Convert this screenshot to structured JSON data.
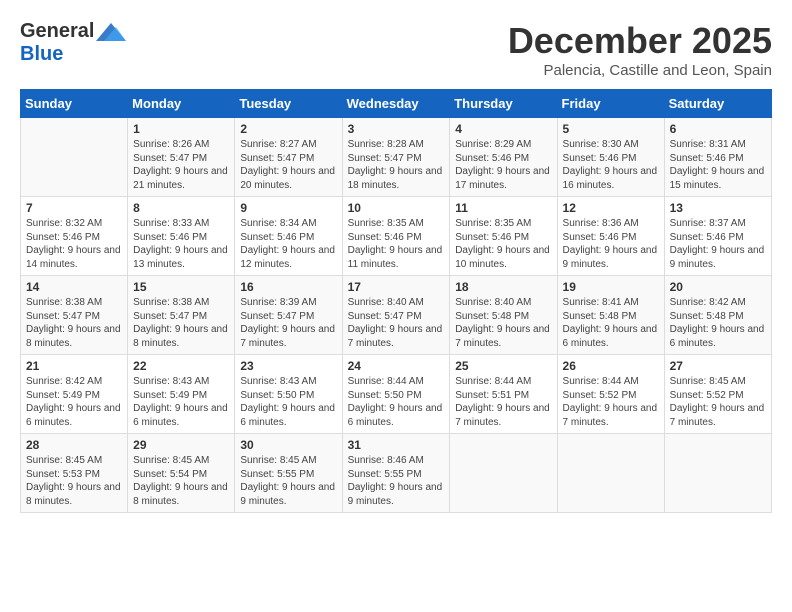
{
  "logo": {
    "general": "General",
    "blue": "Blue"
  },
  "title": "December 2025",
  "subtitle": "Palencia, Castille and Leon, Spain",
  "headers": [
    "Sunday",
    "Monday",
    "Tuesday",
    "Wednesday",
    "Thursday",
    "Friday",
    "Saturday"
  ],
  "weeks": [
    [
      {
        "day": "",
        "sunrise": "",
        "sunset": "",
        "daylight": ""
      },
      {
        "day": "1",
        "sunrise": "Sunrise: 8:26 AM",
        "sunset": "Sunset: 5:47 PM",
        "daylight": "Daylight: 9 hours and 21 minutes."
      },
      {
        "day": "2",
        "sunrise": "Sunrise: 8:27 AM",
        "sunset": "Sunset: 5:47 PM",
        "daylight": "Daylight: 9 hours and 20 minutes."
      },
      {
        "day": "3",
        "sunrise": "Sunrise: 8:28 AM",
        "sunset": "Sunset: 5:47 PM",
        "daylight": "Daylight: 9 hours and 18 minutes."
      },
      {
        "day": "4",
        "sunrise": "Sunrise: 8:29 AM",
        "sunset": "Sunset: 5:46 PM",
        "daylight": "Daylight: 9 hours and 17 minutes."
      },
      {
        "day": "5",
        "sunrise": "Sunrise: 8:30 AM",
        "sunset": "Sunset: 5:46 PM",
        "daylight": "Daylight: 9 hours and 16 minutes."
      },
      {
        "day": "6",
        "sunrise": "Sunrise: 8:31 AM",
        "sunset": "Sunset: 5:46 PM",
        "daylight": "Daylight: 9 hours and 15 minutes."
      }
    ],
    [
      {
        "day": "7",
        "sunrise": "Sunrise: 8:32 AM",
        "sunset": "Sunset: 5:46 PM",
        "daylight": "Daylight: 9 hours and 14 minutes."
      },
      {
        "day": "8",
        "sunrise": "Sunrise: 8:33 AM",
        "sunset": "Sunset: 5:46 PM",
        "daylight": "Daylight: 9 hours and 13 minutes."
      },
      {
        "day": "9",
        "sunrise": "Sunrise: 8:34 AM",
        "sunset": "Sunset: 5:46 PM",
        "daylight": "Daylight: 9 hours and 12 minutes."
      },
      {
        "day": "10",
        "sunrise": "Sunrise: 8:35 AM",
        "sunset": "Sunset: 5:46 PM",
        "daylight": "Daylight: 9 hours and 11 minutes."
      },
      {
        "day": "11",
        "sunrise": "Sunrise: 8:35 AM",
        "sunset": "Sunset: 5:46 PM",
        "daylight": "Daylight: 9 hours and 10 minutes."
      },
      {
        "day": "12",
        "sunrise": "Sunrise: 8:36 AM",
        "sunset": "Sunset: 5:46 PM",
        "daylight": "Daylight: 9 hours and 9 minutes."
      },
      {
        "day": "13",
        "sunrise": "Sunrise: 8:37 AM",
        "sunset": "Sunset: 5:46 PM",
        "daylight": "Daylight: 9 hours and 9 minutes."
      }
    ],
    [
      {
        "day": "14",
        "sunrise": "Sunrise: 8:38 AM",
        "sunset": "Sunset: 5:47 PM",
        "daylight": "Daylight: 9 hours and 8 minutes."
      },
      {
        "day": "15",
        "sunrise": "Sunrise: 8:38 AM",
        "sunset": "Sunset: 5:47 PM",
        "daylight": "Daylight: 9 hours and 8 minutes."
      },
      {
        "day": "16",
        "sunrise": "Sunrise: 8:39 AM",
        "sunset": "Sunset: 5:47 PM",
        "daylight": "Daylight: 9 hours and 7 minutes."
      },
      {
        "day": "17",
        "sunrise": "Sunrise: 8:40 AM",
        "sunset": "Sunset: 5:47 PM",
        "daylight": "Daylight: 9 hours and 7 minutes."
      },
      {
        "day": "18",
        "sunrise": "Sunrise: 8:40 AM",
        "sunset": "Sunset: 5:48 PM",
        "daylight": "Daylight: 9 hours and 7 minutes."
      },
      {
        "day": "19",
        "sunrise": "Sunrise: 8:41 AM",
        "sunset": "Sunset: 5:48 PM",
        "daylight": "Daylight: 9 hours and 6 minutes."
      },
      {
        "day": "20",
        "sunrise": "Sunrise: 8:42 AM",
        "sunset": "Sunset: 5:48 PM",
        "daylight": "Daylight: 9 hours and 6 minutes."
      }
    ],
    [
      {
        "day": "21",
        "sunrise": "Sunrise: 8:42 AM",
        "sunset": "Sunset: 5:49 PM",
        "daylight": "Daylight: 9 hours and 6 minutes."
      },
      {
        "day": "22",
        "sunrise": "Sunrise: 8:43 AM",
        "sunset": "Sunset: 5:49 PM",
        "daylight": "Daylight: 9 hours and 6 minutes."
      },
      {
        "day": "23",
        "sunrise": "Sunrise: 8:43 AM",
        "sunset": "Sunset: 5:50 PM",
        "daylight": "Daylight: 9 hours and 6 minutes."
      },
      {
        "day": "24",
        "sunrise": "Sunrise: 8:44 AM",
        "sunset": "Sunset: 5:50 PM",
        "daylight": "Daylight: 9 hours and 6 minutes."
      },
      {
        "day": "25",
        "sunrise": "Sunrise: 8:44 AM",
        "sunset": "Sunset: 5:51 PM",
        "daylight": "Daylight: 9 hours and 7 minutes."
      },
      {
        "day": "26",
        "sunrise": "Sunrise: 8:44 AM",
        "sunset": "Sunset: 5:52 PM",
        "daylight": "Daylight: 9 hours and 7 minutes."
      },
      {
        "day": "27",
        "sunrise": "Sunrise: 8:45 AM",
        "sunset": "Sunset: 5:52 PM",
        "daylight": "Daylight: 9 hours and 7 minutes."
      }
    ],
    [
      {
        "day": "28",
        "sunrise": "Sunrise: 8:45 AM",
        "sunset": "Sunset: 5:53 PM",
        "daylight": "Daylight: 9 hours and 8 minutes."
      },
      {
        "day": "29",
        "sunrise": "Sunrise: 8:45 AM",
        "sunset": "Sunset: 5:54 PM",
        "daylight": "Daylight: 9 hours and 8 minutes."
      },
      {
        "day": "30",
        "sunrise": "Sunrise: 8:45 AM",
        "sunset": "Sunset: 5:55 PM",
        "daylight": "Daylight: 9 hours and 9 minutes."
      },
      {
        "day": "31",
        "sunrise": "Sunrise: 8:46 AM",
        "sunset": "Sunset: 5:55 PM",
        "daylight": "Daylight: 9 hours and 9 minutes."
      },
      {
        "day": "",
        "sunrise": "",
        "sunset": "",
        "daylight": ""
      },
      {
        "day": "",
        "sunrise": "",
        "sunset": "",
        "daylight": ""
      },
      {
        "day": "",
        "sunrise": "",
        "sunset": "",
        "daylight": ""
      }
    ]
  ]
}
